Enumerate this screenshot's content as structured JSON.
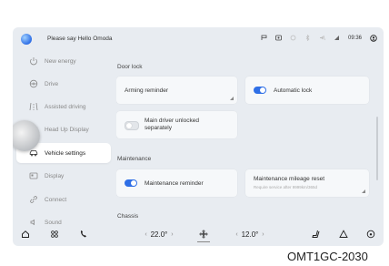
{
  "status_bar": {
    "assistant_prompt": "Please say Hello Omoda",
    "time": "09:36",
    "icons": [
      "parking-icon",
      "radar-icon",
      "seatbelt-icon",
      "bluetooth-icon",
      "mute-icon",
      "signal-icon",
      "user-icon"
    ]
  },
  "sidebar": {
    "items": [
      {
        "label": "New energy",
        "icon": "energy-icon",
        "active": false
      },
      {
        "label": "Drive",
        "icon": "steering-icon",
        "active": false
      },
      {
        "label": "Assisted driving",
        "icon": "assist-icon",
        "active": false
      },
      {
        "label": "Head Up Display",
        "icon": "hud-icon",
        "active": false
      },
      {
        "label": "Vehicle settings",
        "icon": "car-icon",
        "active": true
      },
      {
        "label": "Display",
        "icon": "display-icon",
        "active": false
      },
      {
        "label": "Connect",
        "icon": "link-icon",
        "active": false
      },
      {
        "label": "Sound",
        "icon": "sound-icon",
        "active": false
      }
    ]
  },
  "main": {
    "door_lock": {
      "title": "Door lock",
      "arming_reminder": "Arming reminder",
      "automatic_lock": {
        "label": "Automatic lock",
        "on": true
      },
      "main_driver_unlocked": {
        "label": "Main driver unlocked separately",
        "on": false
      }
    },
    "maintenance": {
      "title": "Maintenance",
      "maintenance_reminder": {
        "label": "Maintenance reminder",
        "on": true
      },
      "mileage_reset": {
        "label": "Maintenance mileage reset",
        "subtext": "Require service after 9999km/365d"
      }
    },
    "chassis": {
      "title": "Chassis"
    }
  },
  "dock": {
    "left_temp": "22.0°",
    "right_temp": "12.0°",
    "items": [
      "home-icon",
      "apps-icon",
      "phone-icon",
      "fan-icon",
      "seat-icon",
      "hazard-icon",
      "steering-icon"
    ]
  },
  "caption": "OMT1GC-2030",
  "colors": {
    "accent": "#2f6fe6",
    "background": "#e8ecf1",
    "card": "#f6f8fa"
  }
}
